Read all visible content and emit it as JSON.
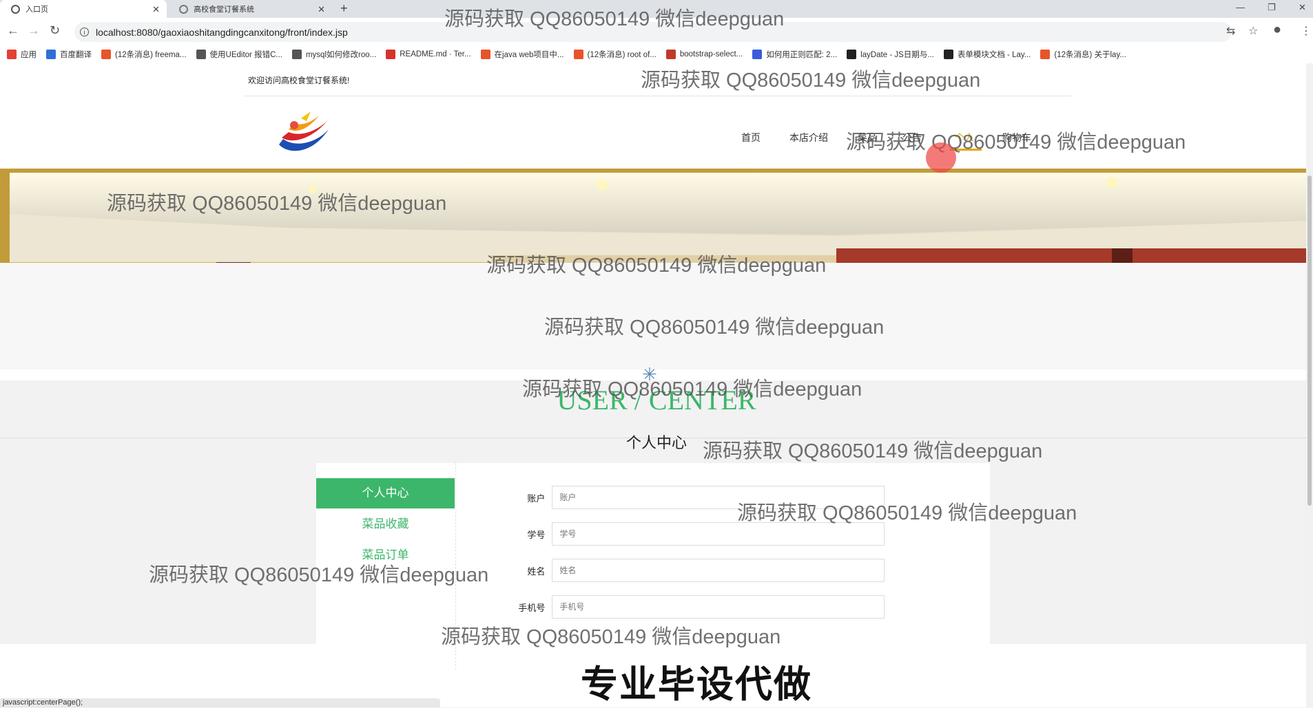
{
  "browser": {
    "tabs": [
      {
        "title": "入口页",
        "active": true
      },
      {
        "title": "高校食堂订餐系统",
        "active": false
      }
    ],
    "new_tab": "+",
    "url": "localhost:8080/gaoxiaoshitangdingcanxitong/front/index.jsp",
    "bookmarks": [
      {
        "label": "应用",
        "color": "#e34133"
      },
      {
        "label": "百度翻译",
        "color": "#2f6fd6"
      },
      {
        "label": "(12条消息) freema...",
        "color": "#e8542a"
      },
      {
        "label": "使用UEditor 报错C...",
        "color": "#555555"
      },
      {
        "label": "mysql如何修改roo...",
        "color": "#555555"
      },
      {
        "label": "README.md · Ter...",
        "color": "#d7332a"
      },
      {
        "label": "在java web项目中...",
        "color": "#e8542a"
      },
      {
        "label": "(12条消息) root of...",
        "color": "#e8542a"
      },
      {
        "label": "bootstrap-select...",
        "color": "#c0392b"
      },
      {
        "label": "如何用正则匹配: 2...",
        "color": "#3b5bdb"
      },
      {
        "label": "layDate - JS日期与...",
        "color": "#222222"
      },
      {
        "label": "表单模块文档 - Lay...",
        "color": "#222222"
      },
      {
        "label": "(12条消息) 关于lay...",
        "color": "#e8542a"
      }
    ]
  },
  "site": {
    "welcome": "欢迎访问高校食堂订餐系统!",
    "nav": [
      {
        "label": "首页",
        "active": false
      },
      {
        "label": "本店介绍",
        "active": false
      },
      {
        "label": "菜品",
        "active": false
      },
      {
        "label": "公告",
        "active": false
      },
      {
        "label": "个人",
        "active": true
      },
      {
        "label": "购物车",
        "active": false
      }
    ],
    "accent": "#3cb66b",
    "nav_active_color": "#e6a800"
  },
  "user_center": {
    "title_en": "USER / CENTER",
    "title_cn": "个人中心",
    "sidebar": [
      {
        "label": "个人中心",
        "active": true
      },
      {
        "label": "菜品收藏",
        "active": false
      },
      {
        "label": "菜品订单",
        "active": false
      }
    ],
    "fields": [
      {
        "label": "账户",
        "placeholder": "账户"
      },
      {
        "label": "学号",
        "placeholder": "学号"
      },
      {
        "label": "姓名",
        "placeholder": "姓名"
      },
      {
        "label": "手机号",
        "placeholder": "手机号"
      }
    ]
  },
  "status_text": "javascript:centerPage();",
  "watermark_text": "源码获取 QQ86050149 微信deepguan",
  "promo_text": "专业毕设代做"
}
